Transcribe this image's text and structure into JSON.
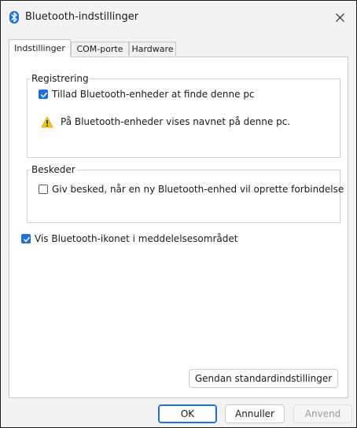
{
  "window": {
    "title": "Bluetooth-indstillinger"
  },
  "icons": {
    "app": "bluetooth-icon",
    "close": "close-icon",
    "warning": "warning-icon",
    "checkmark": "checkmark-icon"
  },
  "colors": {
    "accent": "#1f6fd6",
    "warning": "#f2c511"
  },
  "tabs": [
    {
      "label": "Indstillinger",
      "active": true
    },
    {
      "label": "COM-porte",
      "active": false
    },
    {
      "label": "Hardware",
      "active": false
    }
  ],
  "registrering": {
    "title": "Registrering",
    "allow_discovery": {
      "label": "Tillad Bluetooth-enheder at finde denne pc",
      "checked": true
    },
    "warning_text": "På Bluetooth-enheder vises navnet på denne pc."
  },
  "beskeder": {
    "title": "Beskeder",
    "notify_new": {
      "label": "Giv besked, når en ny Bluetooth-enhed vil oprette forbindelse",
      "checked": false
    }
  },
  "show_icon": {
    "label": "Vis Bluetooth-ikonet i meddelelsesområdet",
    "checked": true
  },
  "buttons": {
    "restore_defaults": "Gendan standardindstillinger",
    "ok": "OK",
    "cancel": "Annuller",
    "apply": "Anvend"
  }
}
